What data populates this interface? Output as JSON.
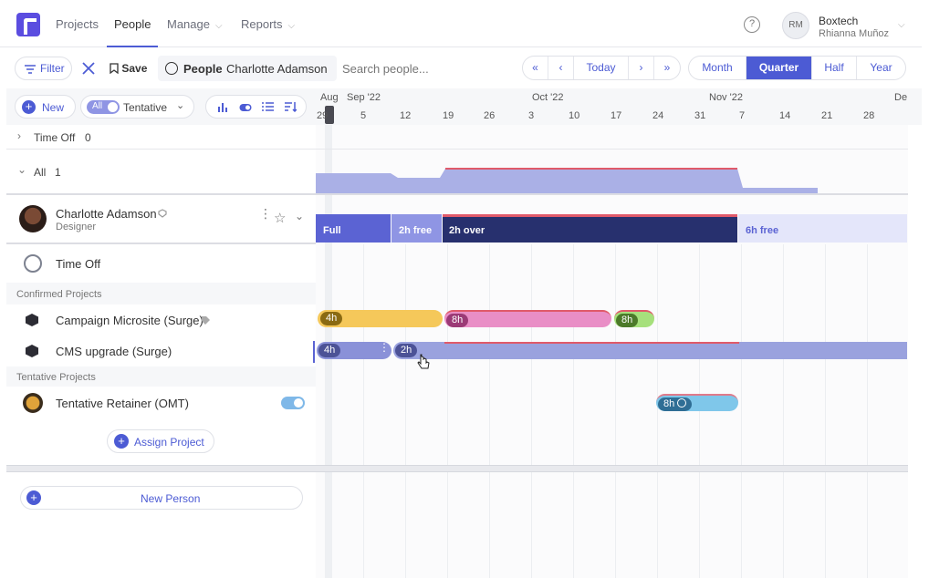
{
  "nav": {
    "items": [
      "Projects",
      "People",
      "Manage",
      "Reports"
    ],
    "active": "People",
    "help": "?",
    "account": {
      "initials": "RM",
      "org": "Boxtech",
      "user": "Rhianna Muñoz"
    }
  },
  "toolbar": {
    "filter": "Filter",
    "save": "Save",
    "view_type": "People",
    "view_value": "Charlotte Adamson",
    "search_placeholder": "Search people...",
    "today": "Today",
    "ranges": [
      "Month",
      "Quarter",
      "Half",
      "Year"
    ],
    "active_range": "Quarter"
  },
  "subtoolbar": {
    "new": "New",
    "toggle_label": "All",
    "tentative": "Tentative"
  },
  "timeline": {
    "months": [
      "Aug",
      "Sep '22",
      "Oct '22",
      "Nov '22",
      "De"
    ],
    "weeks": [
      "29",
      "5",
      "12",
      "19",
      "26",
      "3",
      "10",
      "17",
      "24",
      "31",
      "7",
      "14",
      "21",
      "28"
    ]
  },
  "groups": {
    "time_off": {
      "label": "Time Off",
      "count": "0"
    },
    "all": {
      "label": "All",
      "count": "1"
    }
  },
  "person": {
    "name": "Charlotte Adamson",
    "role": "Designer",
    "capacity": [
      {
        "label": "Full",
        "color": "#5b63d3"
      },
      {
        "label": "2h free",
        "color": "#8f95e4"
      },
      {
        "label": "2h over",
        "color": "#27306e"
      },
      {
        "label": "6h free",
        "color": "#e4e6fa"
      }
    ]
  },
  "rows": {
    "time_off": "Time Off",
    "confirmed_label": "Confirmed Projects",
    "campaign": "Campaign Microsite (Surge)",
    "cms": "CMS upgrade (Surge)",
    "tentative_label": "Tentative Projects",
    "retainer": "Tentative Retainer (OMT)",
    "assign": "Assign Project",
    "new_person": "New Person"
  },
  "bars": {
    "campaign": [
      "4h",
      "8h",
      "8h"
    ],
    "cms": [
      "4h",
      "2h"
    ],
    "retainer": "8h"
  },
  "colors": {
    "accent": "#4c5bd4",
    "yellow": "#f5c85a",
    "pink": "#e98ec6",
    "green": "#a6e07c",
    "cms": "#9aa2de",
    "retainer": "#7fc7ea",
    "over": "#e05a6a"
  }
}
